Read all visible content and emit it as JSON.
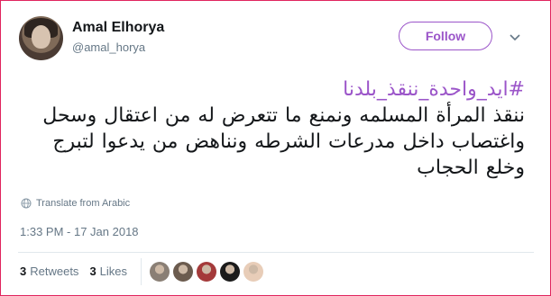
{
  "user": {
    "display_name": "Amal Elhorya",
    "handle": "@amal_horya",
    "avatar_icon": "profile-photo"
  },
  "follow_label": "Follow",
  "menu_icon": "chevron-down-icon",
  "tweet": {
    "hashtag": "#ايد_واحدة_ننقذ_بلدنا",
    "body": "ننقذ المرأة المسلمه ونمنع ما تتعرض له من اعتقال وسحل\nواغتصاب داخل مدرعات الشرطه  ونناهض من يدعوا لتبرج\nوخلع الحجاب"
  },
  "translate_label": "Translate from Arabic",
  "translate_icon": "globe-icon",
  "timestamp": "1:33 PM - 17 Jan 2018",
  "stats": {
    "retweets_count": "3",
    "retweets_label": "Retweets",
    "likes_count": "3",
    "likes_label": "Likes"
  },
  "likers": [
    {
      "color": "#8a7f75"
    },
    {
      "color": "#6b5b4e"
    },
    {
      "color": "#a43a3a"
    },
    {
      "color": "#1b1b1b"
    },
    {
      "color": "#e8cdb8"
    }
  ],
  "colors": {
    "accent": "#9b55c9",
    "text": "#14171a",
    "muted": "#657786",
    "border": "#e0245e"
  }
}
